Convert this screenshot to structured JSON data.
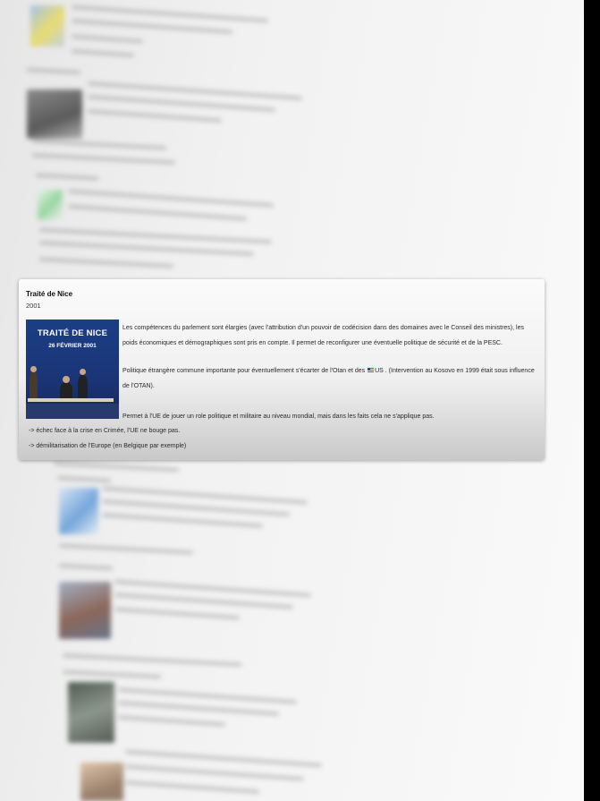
{
  "card": {
    "title": "Traité de Nice",
    "year": "2001",
    "image": {
      "title": "TRAITÉ DE NICE",
      "date": "26 FÉVRIER 2001"
    },
    "paragraph1": "Les compétences du parlement sont élargies (avec l'attribution d'un pouvoir de codécision dans des domaines avec le Conseil des ministres), les poids économiques et démographiques sont pris en compte. Il permet de reconfigurer une éventuelle politique de sécurité et de la PESC.",
    "paragraph2_before": "Politique étrangère commune importante pour éventuellement s'écarter de l'Otan et des ",
    "paragraph2_flag": "us-flag-icon",
    "paragraph2_after": "US . (Intervention au Kosovo en 1999 était sous influence de l'OTAN).",
    "paragraph3": "Permet à l'UE de jouer un role politique et militaire au niveau mondial, mais dans les faits cela ne s'applique pas.",
    "bullet1": "-> échec face à la crise en Crimée, l'UE ne bouge pas.",
    "bullet2": "-> démilitarisation de l'Europe (en Belgique par exemple)"
  }
}
